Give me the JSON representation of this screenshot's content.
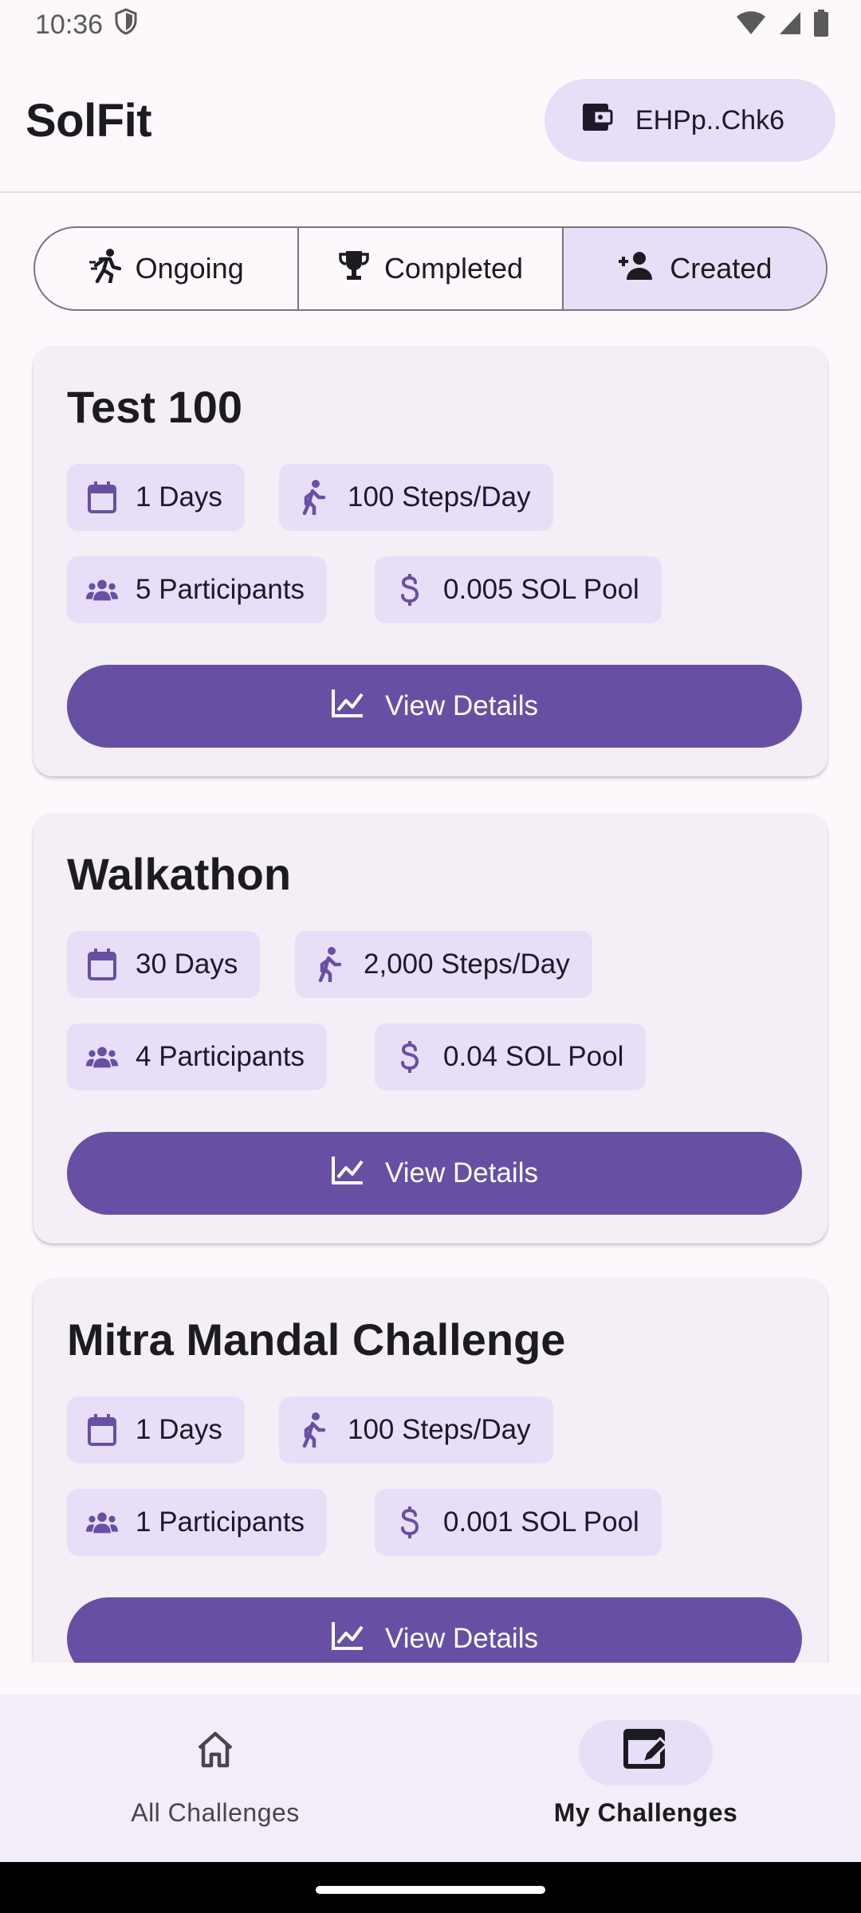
{
  "status_bar": {
    "time": "10:36"
  },
  "app_bar": {
    "title": "SolFit",
    "wallet_label": "EHPp..Chk6"
  },
  "tabs": [
    {
      "label": "Ongoing",
      "icon": "running-icon",
      "selected": false
    },
    {
      "label": "Completed",
      "icon": "trophy-icon",
      "selected": false
    },
    {
      "label": "Created",
      "icon": "person-add-icon",
      "selected": true
    }
  ],
  "challenges": [
    {
      "title": "Test 100",
      "duration": "1 Days",
      "steps": "100 Steps/Day",
      "participants": "5 Participants",
      "pool": "0.005 SOL Pool",
      "button": "View Details"
    },
    {
      "title": "Walkathon",
      "duration": "30 Days",
      "steps": "2,000 Steps/Day",
      "participants": "4 Participants",
      "pool": "0.04 SOL Pool",
      "button": "View Details"
    },
    {
      "title": "Mitra Mandal Challenge",
      "duration": "1 Days",
      "steps": "100 Steps/Day",
      "participants": "1 Participants",
      "pool": "0.001 SOL Pool",
      "button": "View Details"
    }
  ],
  "bottom_nav": [
    {
      "label": "All Challenges",
      "icon": "home-icon",
      "active": false
    },
    {
      "label": "My Challenges",
      "icon": "edit-calendar-icon",
      "active": true
    }
  ],
  "colors": {
    "primary": "#6750a4",
    "secondary_container": "#e8def8",
    "surface": "#fdf8fc",
    "card": "#f4eff6"
  }
}
